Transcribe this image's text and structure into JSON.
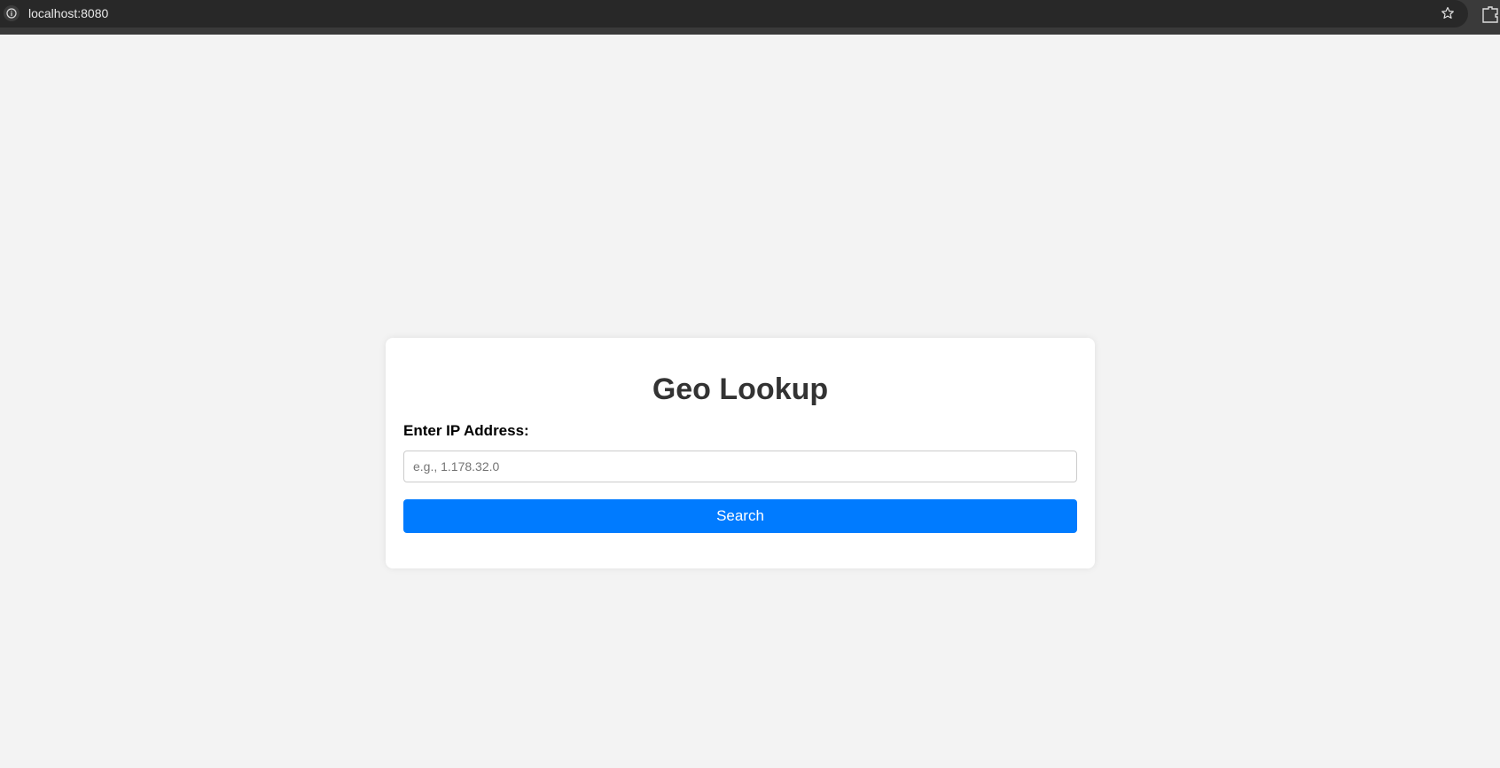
{
  "browser": {
    "url": "localhost:8080",
    "icons": {
      "site_info": "info-icon",
      "bookmark": "star-icon",
      "extensions": "extensions-icon"
    }
  },
  "form": {
    "title": "Geo Lookup",
    "ip_label": "Enter IP Address:",
    "ip_placeholder": "e.g., 1.178.32.0",
    "ip_value": "",
    "search_label": "Search"
  },
  "colors": {
    "accent": "#007bff",
    "page_background": "#f3f3f3",
    "card_background": "#ffffff",
    "browser_chrome": "#282828"
  }
}
